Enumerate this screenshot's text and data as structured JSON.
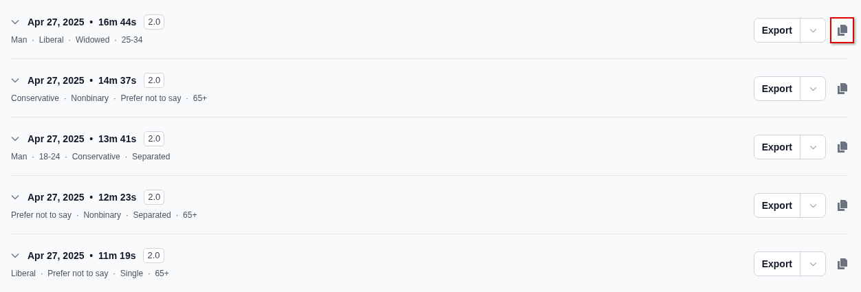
{
  "sessions": [
    {
      "title": "Apr 27, 2025  •  16m 44s",
      "version": "2.0",
      "meta": "Man  ·  Liberal  ·  Widowed  ·  25-34",
      "export": "Export",
      "highlighted": true
    },
    {
      "title": "Apr 27, 2025  •  14m 37s",
      "version": "2.0",
      "meta": "Conservative  ·  Nonbinary  ·  Prefer not to say  ·  65+",
      "export": "Export",
      "highlighted": false
    },
    {
      "title": "Apr 27, 2025  •  13m 41s",
      "version": "2.0",
      "meta": "Man  ·  18-24  ·  Conservative  ·  Separated",
      "export": "Export",
      "highlighted": false
    },
    {
      "title": "Apr 27, 2025  •  12m 23s",
      "version": "2.0",
      "meta": "Prefer not to say  ·  Nonbinary  ·  Separated  ·  65+",
      "export": "Export",
      "highlighted": false
    },
    {
      "title": "Apr 27, 2025  •  11m 19s",
      "version": "2.0",
      "meta": "Liberal  ·  Prefer not to say  ·  Single  ·  65+",
      "export": "Export",
      "highlighted": false
    }
  ]
}
